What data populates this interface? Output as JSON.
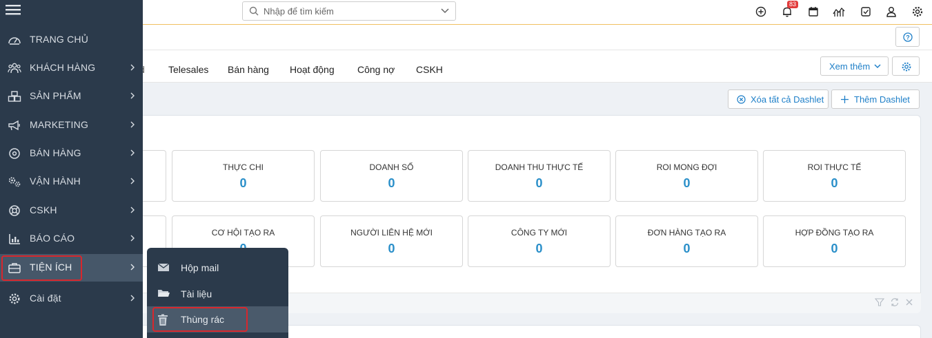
{
  "search": {
    "placeholder": "Nhập để tìm kiếm"
  },
  "notifications": {
    "count": "83"
  },
  "header_icons": [
    "plus-circle-icon",
    "bell-icon",
    "calendar-icon",
    "chart-icon",
    "checkbox-icon",
    "user-icon",
    "gear-icon"
  ],
  "tabs": {
    "partial": "d",
    "items": [
      "Telesales",
      "Bán hàng",
      "Hoạt động",
      "Công nợ",
      "CSKH"
    ]
  },
  "buttons": {
    "more": "Xem thêm",
    "clear_dashlets": "Xóa tất cả Dashlet",
    "add_dashlet": "Thêm Dashlet"
  },
  "stats_row1": [
    {
      "label": "THỰC CHI",
      "value": "0"
    },
    {
      "label": "DOANH SỐ",
      "value": "0"
    },
    {
      "label": "DOANH THU THỰC TẾ",
      "value": "0"
    },
    {
      "label": "ROI MONG ĐỢI",
      "value": "0"
    },
    {
      "label": "ROI THỰC TẾ",
      "value": "0"
    }
  ],
  "stats_row2": [
    {
      "label": "CƠ HỘI TẠO RA",
      "value": "0"
    },
    {
      "label": "NGƯỜI LIÊN HỆ MỚI",
      "value": "0"
    },
    {
      "label": "CÔNG TY MỚI",
      "value": "0"
    },
    {
      "label": "ĐƠN HÀNG TẠO RA",
      "value": "0"
    },
    {
      "label": "HỢP ĐỒNG TẠO RA",
      "value": "0"
    }
  ],
  "sidebar": {
    "items": [
      {
        "label": "TRANG CHỦ",
        "icon": "dashboard-icon"
      },
      {
        "label": "KHÁCH HÀNG",
        "icon": "users-icon"
      },
      {
        "label": "SẢN PHẨM",
        "icon": "boxes-icon"
      },
      {
        "label": "MARKETING",
        "icon": "megaphone-icon"
      },
      {
        "label": "BÁN HÀNG",
        "icon": "target-icon"
      },
      {
        "label": "VẬN HÀNH",
        "icon": "cogs-icon"
      },
      {
        "label": "CSKH",
        "icon": "lifebuoy-icon"
      },
      {
        "label": "BÁO CÁO",
        "icon": "bar-chart-icon"
      },
      {
        "label": "TIỆN ÍCH",
        "icon": "briefcase-icon"
      },
      {
        "label": "Cài đặt",
        "icon": "gear-icon"
      }
    ]
  },
  "submenu": {
    "items": [
      {
        "label": "Hộp mail",
        "icon": "envelope-icon"
      },
      {
        "label": "Tài liệu",
        "icon": "folder-icon"
      },
      {
        "label": "Thùng rác",
        "icon": "trash-icon"
      }
    ]
  },
  "colors": {
    "sidebar_bg": "#2b3a4b",
    "accent_blue": "#2a8fc9",
    "highlight_red": "#d9262c",
    "badge_red": "#e23c3c"
  }
}
